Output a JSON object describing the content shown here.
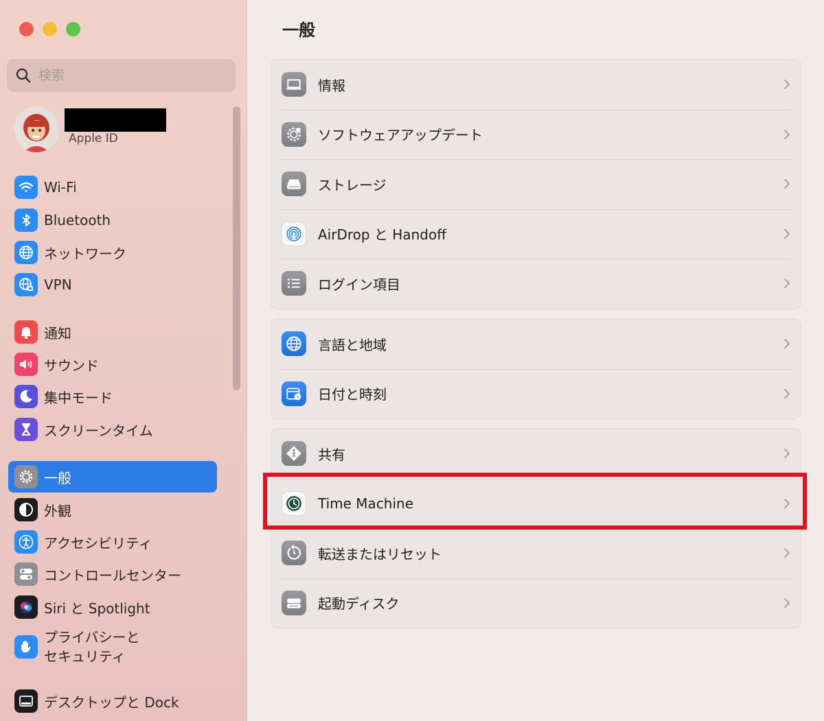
{
  "window": {
    "traffic_lights": [
      "close",
      "minimize",
      "zoom"
    ]
  },
  "sidebar": {
    "search_placeholder": "検索",
    "apple_id_label": "Apple ID",
    "items": [
      {
        "label": "Wi-Fi",
        "icon": "wifi-icon",
        "color": "#2b8cf4"
      },
      {
        "label": "Bluetooth",
        "icon": "bluetooth-icon",
        "color": "#2b8cf4"
      },
      {
        "label": "ネットワーク",
        "icon": "globe-icon",
        "color": "#2b8cf4"
      },
      {
        "label": "VPN",
        "icon": "vpn-globe-icon",
        "color": "#2b8cf4"
      },
      {
        "label": "通知",
        "icon": "bell-icon",
        "color": "#f04a4a"
      },
      {
        "label": "サウンド",
        "icon": "speaker-icon",
        "color": "#f0446a"
      },
      {
        "label": "集中モード",
        "icon": "moon-icon",
        "color": "#5a4fd8"
      },
      {
        "label": "スクリーンタイム",
        "icon": "hourglass-icon",
        "color": "#6a4fd8"
      },
      {
        "label": "一般",
        "icon": "gear-icon",
        "color": "#8e8e93",
        "active": true
      },
      {
        "label": "外観",
        "icon": "appearance-icon",
        "color": "#1d1d1f"
      },
      {
        "label": "アクセシビリティ",
        "icon": "accessibility-icon",
        "color": "#2b8cf4"
      },
      {
        "label": "コントロールセンター",
        "icon": "toggles-icon",
        "color": "#8e8e93"
      },
      {
        "label": "Siri と Spotlight",
        "icon": "siri-icon",
        "color": "#1d1d1f"
      },
      {
        "label_line1": "プライバシーと",
        "label_line2": "セキュリティ",
        "icon": "hand-icon",
        "color": "#2b8cf4"
      },
      {
        "label": "デスクトップと Dock",
        "icon": "dock-icon",
        "color": "#1d1d1f"
      }
    ]
  },
  "main": {
    "title": "一般",
    "groups": [
      [
        {
          "label": "情報",
          "icon": "laptop-icon"
        },
        {
          "label": "ソフトウェアアップデート",
          "icon": "gear-badge-icon"
        },
        {
          "label": "ストレージ",
          "icon": "drive-icon"
        },
        {
          "label": "AirDrop と Handoff",
          "icon": "airdrop-icon"
        },
        {
          "label": "ログイン項目",
          "icon": "list-icon"
        }
      ],
      [
        {
          "label": "言語と地域",
          "icon": "globe-icon"
        },
        {
          "label": "日付と時刻",
          "icon": "calendar-clock-icon"
        }
      ],
      [
        {
          "label": "共有",
          "icon": "sharing-icon"
        },
        {
          "label": "Time Machine",
          "icon": "time-machine-icon",
          "highlighted": true
        },
        {
          "label": "転送またはリセット",
          "icon": "reset-icon"
        },
        {
          "label": "起動ディスク",
          "icon": "startup-disk-icon"
        }
      ]
    ],
    "highlight_color": "#e0121f"
  }
}
